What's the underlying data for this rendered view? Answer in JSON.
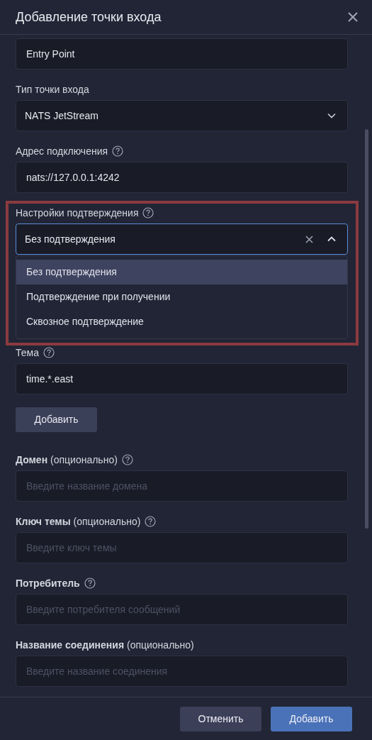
{
  "dialog": {
    "title": "Добавление точки входа"
  },
  "fields": [
    {
      "kind": "text",
      "value": "Entry Point"
    },
    {
      "kind": "select",
      "label": "Тип точки входа",
      "value": "NATS JetStream",
      "expanded": false
    },
    {
      "kind": "text",
      "label": "Адрес подключения",
      "help": true,
      "value": "nats://127.0.0.1:4242"
    },
    {
      "kind": "select",
      "label": "Настройки подтверждения",
      "help": true,
      "value": "Без подтверждения",
      "expanded": true,
      "clearable": true,
      "highlighted": true,
      "options": [
        {
          "label": "Без подтверждения",
          "selected": true
        },
        {
          "label": "Подтверждение при получении",
          "selected": false
        },
        {
          "label": "Сквозное подтверждение",
          "selected": false
        }
      ]
    },
    {
      "kind": "text",
      "label": "Тема",
      "help": true,
      "value": "time.*.east"
    },
    {
      "kind": "button",
      "label": "Добавить"
    },
    {
      "kind": "text",
      "label": "**Домен** (опционально)",
      "help": true,
      "placeholder": "Введите название домена"
    },
    {
      "kind": "text",
      "label": "**Ключ темы** (опционально)",
      "help": true,
      "placeholder": "Введите ключ темы"
    },
    {
      "kind": "text",
      "label": "**Потребитель**",
      "help": true,
      "placeholder": "Введите потребителя сообщений"
    },
    {
      "kind": "text",
      "label": "**Название соединения** (опционально)",
      "help": false,
      "placeholder": "Введите название соединения"
    }
  ],
  "footer": {
    "buttons": [
      {
        "label": "Отменить",
        "kind": "secondary"
      },
      {
        "label": "Добавить",
        "kind": "primary"
      }
    ]
  }
}
